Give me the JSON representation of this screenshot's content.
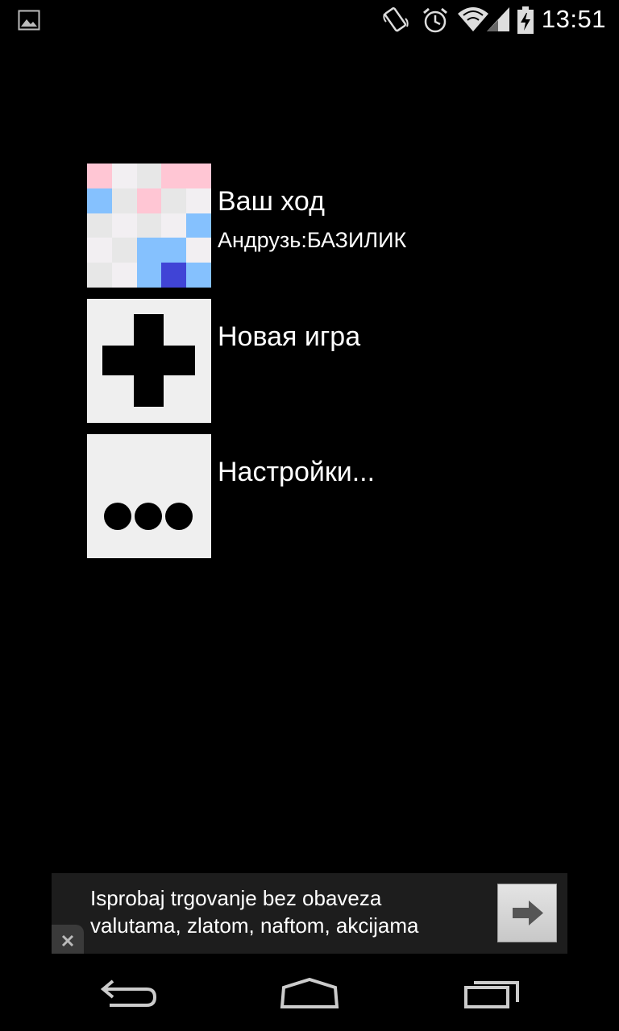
{
  "status_bar": {
    "time": "13:51",
    "icons": [
      "gallery-icon",
      "rotate-phone-icon",
      "alarm-icon",
      "wifi-icon",
      "signal-icon",
      "battery-charging-icon"
    ]
  },
  "menu": {
    "items": [
      {
        "title": "Ваш ход",
        "subtitle": "Андрузь:БАЗИЛИК",
        "thumbnail": "board-preview",
        "board_colors": [
          [
            "#ffc6d4",
            "#f2eff2",
            "#e7e7e7",
            "#ffc6d4",
            "#ffc6d4"
          ],
          [
            "#85c1fe",
            "#e7e7e7",
            "#ffc6d4",
            "#e7e7e7",
            "#f2eff2"
          ],
          [
            "#e7e7e7",
            "#f2eff2",
            "#e7e7e7",
            "#f2eff2",
            "#85c1fe"
          ],
          [
            "#f2eff2",
            "#e7e7e7",
            "#85c1fe",
            "#85c1fe",
            "#f2eff2"
          ],
          [
            "#e7e7e7",
            "#f2eff2",
            "#85c1fe",
            "#4044d6",
            "#85c1fe"
          ]
        ]
      },
      {
        "title": "Новая игра",
        "thumbnail": "plus-icon"
      },
      {
        "title": "Настройки...",
        "thumbnail": "more-dots-icon"
      }
    ]
  },
  "ad_banner": {
    "line1": "Isprobaj trgovanje bez obaveza",
    "line2": "valutama, zlatom, naftom, akcijama",
    "close_icon": "close-icon",
    "action_icon": "arrow-right-icon"
  },
  "nav_bar": {
    "icons": [
      "back-icon",
      "home-icon",
      "recent-apps-icon"
    ]
  }
}
